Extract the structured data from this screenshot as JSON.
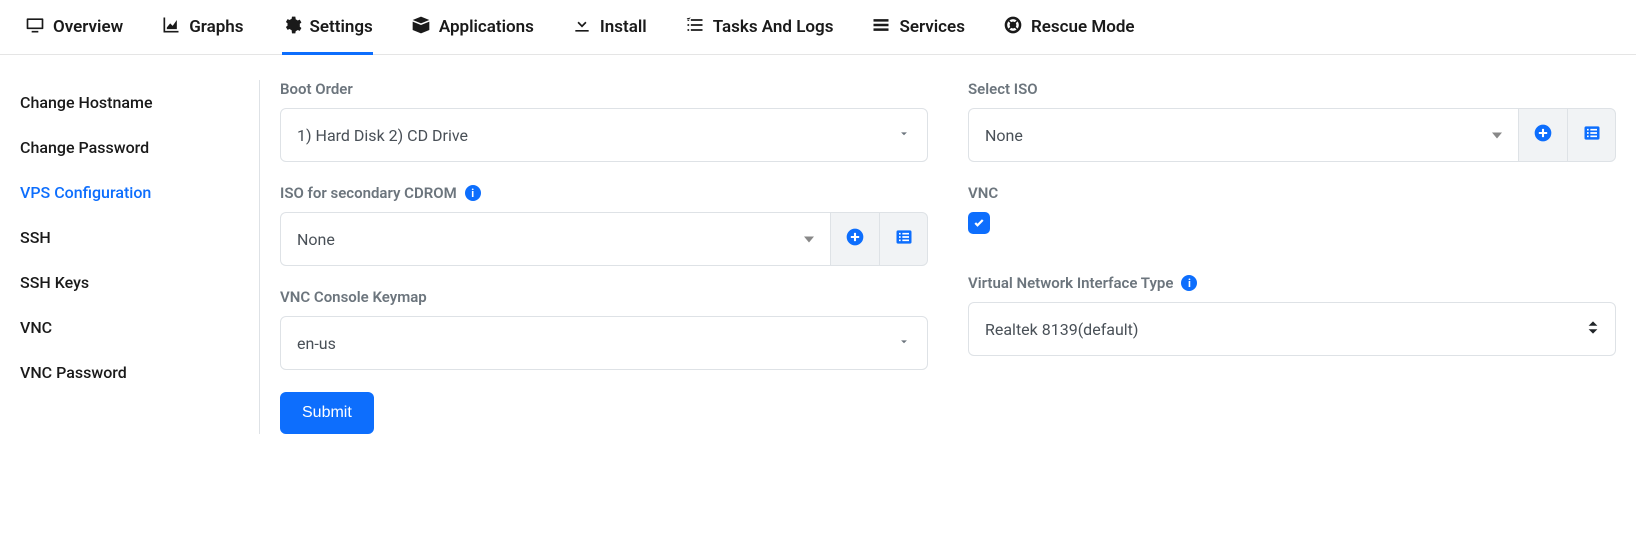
{
  "tabs": {
    "overview": "Overview",
    "graphs": "Graphs",
    "settings": "Settings",
    "applications": "Applications",
    "install": "Install",
    "tasks": "Tasks And Logs",
    "services": "Services",
    "rescue": "Rescue Mode"
  },
  "sidebar": {
    "items": [
      "Change Hostname",
      "Change Password",
      "VPS Configuration",
      "SSH",
      "SSH Keys",
      "VNC",
      "VNC Password"
    ]
  },
  "form": {
    "boot_order": {
      "label": "Boot Order",
      "value": "1) Hard Disk 2) CD Drive"
    },
    "select_iso": {
      "label": "Select ISO",
      "value": "None"
    },
    "iso_secondary": {
      "label": "ISO for secondary CDROM",
      "value": "None"
    },
    "vnc": {
      "label": "VNC",
      "checked": true
    },
    "vnc_keymap": {
      "label": "VNC Console Keymap",
      "value": "en-us"
    },
    "vnic_type": {
      "label": "Virtual Network Interface Type",
      "value": "Realtek 8139(default)"
    },
    "submit": "Submit"
  }
}
